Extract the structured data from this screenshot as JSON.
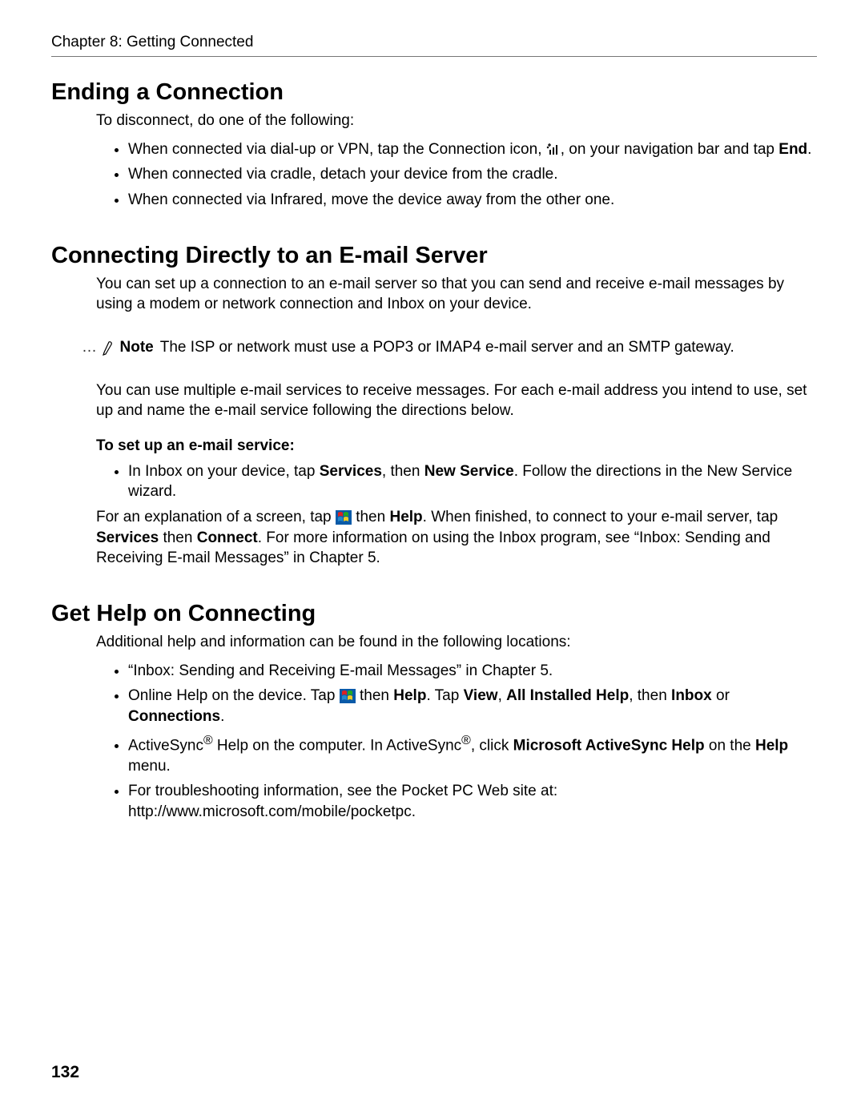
{
  "header": {
    "chapter_line": "Chapter 8: Getting Connected"
  },
  "page_number": "132",
  "section1": {
    "title": "Ending a Connection",
    "intro": "To disconnect, do one of the following:",
    "bullets": {
      "b1a": "When connected via dial-up or VPN, tap the Connection icon, ",
      "b1b": ", on your navigation bar and tap ",
      "b1c": "End",
      "b1d": ".",
      "b2": "When connected via cradle, detach your device from the cradle.",
      "b3": "When connected via Infrared, move the device away from the other one."
    }
  },
  "section2": {
    "title": "Connecting Directly to an E-mail Server",
    "p1": "You can set up a connection to an e-mail server so that you can send and receive e-mail messages by using a modem or network connection and Inbox on your device.",
    "note_label": "Note",
    "note_text": "The ISP or network must use a POP3 or IMAP4 e-mail server and an SMTP gateway.",
    "p2": "You can use multiple e-mail services to receive messages. For each e-mail address you intend to use, set up and name the e-mail service following the directions below.",
    "sub1": "To set up an e-mail service:",
    "bullet1_a": "In Inbox on your device, tap ",
    "bullet1_b": "Services",
    "bullet1_c": ", then ",
    "bullet1_d": "New Service",
    "bullet1_e": ". Follow the directions in the New Service wizard.",
    "p3a": "For an explanation of a screen, tap ",
    "p3b": " then ",
    "p3c": "Help",
    "p3d": ". When finished, to connect to your e-mail server, tap ",
    "p3e": "Services",
    "p3f": " then ",
    "p3g": "Connect",
    "p3h": ". For more information on using the Inbox program, see “Inbox: Sending and Receiving E-mail Messages” in Chapter 5."
  },
  "section3": {
    "title": "Get Help on Connecting",
    "intro": "Additional help and information can be found in the following locations:",
    "b1": "“Inbox: Sending and Receiving E-mail Messages” in Chapter 5.",
    "b2a": "Online Help on the device. Tap ",
    "b2b": " then ",
    "b2c": "Help",
    "b2d": ". Tap ",
    "b2e": "View",
    "b2f": ", ",
    "b2g": "All Installed Help",
    "b2h": ", then ",
    "b2i": "Inbox",
    "b2j": " or ",
    "b2k": "Connections",
    "b2l": ".",
    "b3a": "ActiveSync",
    "b3b": " Help on the computer. In ActiveSync",
    "b3c": ", click ",
    "b3d": "Microsoft ActiveSync Help",
    "b3e": " on the ",
    "b3f": "Help",
    "b3g": " menu.",
    "b4": "For troubleshooting information, see the Pocket PC Web site at: http://www.microsoft.com/mobile/pocketpc."
  }
}
